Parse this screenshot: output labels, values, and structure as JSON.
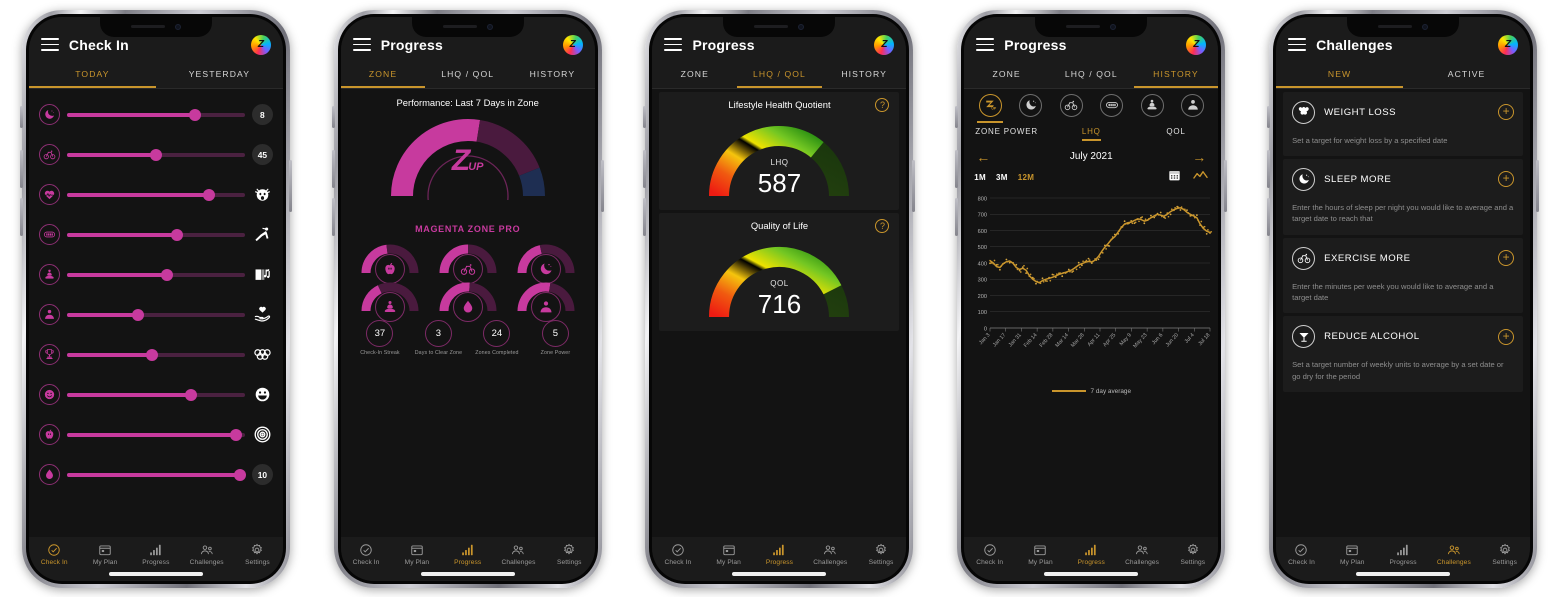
{
  "nav": {
    "items": [
      {
        "label": "Check In",
        "icon": "check-circle-icon"
      },
      {
        "label": "My Plan",
        "icon": "calendar-icon"
      },
      {
        "label": "Progress",
        "icon": "bar-chart-icon"
      },
      {
        "label": "Challenges",
        "icon": "people-icon"
      },
      {
        "label": "Settings",
        "icon": "gear-icon"
      }
    ]
  },
  "avatar": {
    "letter": "Z"
  },
  "screen1": {
    "title": "Check In",
    "tabs": [
      {
        "label": "TODAY",
        "active": true
      },
      {
        "label": "YESTERDAY",
        "active": false
      }
    ],
    "sliders": [
      {
        "icon": "moon-icon",
        "pct": 72,
        "value": "8",
        "value_type": "number"
      },
      {
        "icon": "bicycle-icon",
        "pct": 50,
        "value": "45",
        "value_type": "number"
      },
      {
        "icon": "heartbeat-icon",
        "pct": 80,
        "value": "stressed-face-icon",
        "value_type": "icon"
      },
      {
        "icon": "scale-icon",
        "pct": 62,
        "value": "stretching-icon",
        "value_type": "icon"
      },
      {
        "icon": "meditation-icon",
        "pct": 56,
        "value": "book-music-icon",
        "value_type": "icon"
      },
      {
        "icon": "person-icon",
        "pct": 40,
        "value": "heart-hand-icon",
        "value_type": "icon"
      },
      {
        "icon": "trophy-icon",
        "pct": 48,
        "value": "olympic-rings-icon",
        "value_type": "icon"
      },
      {
        "icon": "smiley-icon",
        "pct": 70,
        "value": "happy-face-icon",
        "value_type": "icon"
      },
      {
        "icon": "apple-icon",
        "pct": 95,
        "value": "target-icon",
        "value_type": "icon"
      },
      {
        "icon": "water-drop-icon",
        "pct": 97,
        "value": "10",
        "value_type": "number"
      }
    ]
  },
  "screen2": {
    "title": "Progress",
    "tabs": [
      {
        "label": "ZONE",
        "active": true
      },
      {
        "label": "LHQ / QOL",
        "active": false
      },
      {
        "label": "HISTORY",
        "active": false
      }
    ],
    "heading": "Performance: Last 7 Days in Zone",
    "logo_text": "Z",
    "logo_sub": "UP",
    "zone_name": "MAGENTA ZONE PRO",
    "gauge_segments": [
      {
        "name": "filled",
        "pct": 55,
        "color": "#c73a9e"
      },
      {
        "name": "remaining",
        "pct": 33,
        "color": "#4a1a3e"
      },
      {
        "name": "locked",
        "pct": 12,
        "color": "#1e2e52"
      }
    ],
    "mini_gauges": [
      {
        "icon": "apple-icon",
        "pct": 46
      },
      {
        "icon": "bicycle-icon",
        "pct": 50
      },
      {
        "icon": "moon-icon",
        "pct": 43
      },
      {
        "icon": "meditation-icon",
        "pct": 36
      },
      {
        "icon": "water-drop-icon",
        "pct": 52
      },
      {
        "icon": "person-icon",
        "pct": 55
      }
    ],
    "stats": [
      {
        "value": "37",
        "label": "Check-In Streak"
      },
      {
        "value": "3",
        "label": "Days to Clear Zone"
      },
      {
        "value": "24",
        "label": "Zones Completed"
      },
      {
        "value": "5",
        "label": "Zone Power"
      }
    ]
  },
  "screen3": {
    "title": "Progress",
    "tabs": [
      {
        "label": "ZONE",
        "active": false
      },
      {
        "label": "LHQ / QOL",
        "active": true
      },
      {
        "label": "HISTORY",
        "active": false
      }
    ],
    "cards": [
      {
        "title": "Lifestyle Health Quotient",
        "sub": "LHQ",
        "value": "587",
        "pct": 72,
        "help": "?"
      },
      {
        "title": "Quality of Life",
        "sub": "QOL",
        "value": "716",
        "pct": 85,
        "help": "?"
      }
    ]
  },
  "screen4": {
    "title": "Progress",
    "tabs": [
      {
        "label": "ZONE",
        "active": false
      },
      {
        "label": "LHQ / QOL",
        "active": false
      },
      {
        "label": "HISTORY",
        "active": true
      }
    ],
    "filters": [
      {
        "icon": "z-logo-icon",
        "active": true
      },
      {
        "icon": "moon-icon",
        "active": false
      },
      {
        "icon": "bicycle-icon",
        "active": false
      },
      {
        "icon": "scale-icon",
        "active": false
      },
      {
        "icon": "meditation-icon",
        "active": false
      },
      {
        "icon": "person-icon",
        "active": false
      }
    ],
    "sub_tabs": [
      {
        "label": "ZONE POWER",
        "active": false
      },
      {
        "label": "LHQ",
        "active": true
      },
      {
        "label": "QOL",
        "active": false
      }
    ],
    "month": "July 2021",
    "prev_arrow": "←",
    "next_arrow": "→",
    "ranges": [
      {
        "label": "1M",
        "active": false
      },
      {
        "label": "3M",
        "active": false
      },
      {
        "label": "12M",
        "active": true
      }
    ],
    "range_icons": [
      {
        "name": "calendar-icon"
      },
      {
        "name": "line-chart-icon"
      }
    ],
    "legend_text": "7 day average"
  },
  "screen5": {
    "title": "Challenges",
    "tabs": [
      {
        "label": "NEW",
        "active": true
      },
      {
        "label": "ACTIVE",
        "active": false
      }
    ],
    "challenges": [
      {
        "icon": "weight-icon",
        "title": "WEIGHT LOSS",
        "desc": "Set a target for weight loss by a specified date",
        "add": "+"
      },
      {
        "icon": "moon-icon",
        "title": "SLEEP MORE",
        "desc": "Enter the hours of sleep per night you would like to average and a target date to reach that",
        "add": "+"
      },
      {
        "icon": "bicycle-icon",
        "title": "EXERCISE MORE",
        "desc": "Enter the minutes per week you would like to average and a target date",
        "add": "+"
      },
      {
        "icon": "cocktail-icon",
        "title": "REDUCE ALCOHOL",
        "desc": "Set a target number of weekly units to average by a set date or go dry for the period",
        "add": "+"
      }
    ]
  },
  "chart_data": {
    "type": "line",
    "title": "LHQ History",
    "xlabel": "",
    "ylabel": "",
    "ylim": [
      0,
      800
    ],
    "yticks": [
      0,
      100,
      200,
      300,
      400,
      500,
      600,
      700,
      800
    ],
    "grid": true,
    "legend": "7 day average",
    "line_color": "#c9952c",
    "xticks": [
      "Jan 3",
      "Jan 17",
      "Jan 31",
      "Feb 14",
      "Feb 28",
      "Mar 14",
      "Mar 28",
      "Apr 11",
      "Apr 25",
      "May 9",
      "May 23",
      "Jun 6",
      "Jun 20",
      "Jul 4",
      "Jul 18"
    ],
    "series": [
      {
        "name": "7 day average",
        "values": [
          415,
          400,
          378,
          372,
          395,
          408,
          412,
          398,
          372,
          360,
          368,
          355,
          322,
          300,
          286,
          279,
          292,
          300,
          306,
          312,
          320,
          330,
          336,
          342,
          350,
          358,
          372,
          388,
          396,
          404,
          410,
          406,
          418,
          440,
          470,
          498,
          520,
          545,
          562,
          590,
          618,
          640,
          648,
          652,
          662,
          672,
          668,
          658,
          664,
          678,
          690,
          700,
          694,
          688,
          700,
          716,
          728,
          736,
          740,
          730,
          712,
          700,
          690,
          678,
          640,
          612,
          596,
          588
        ]
      }
    ]
  }
}
